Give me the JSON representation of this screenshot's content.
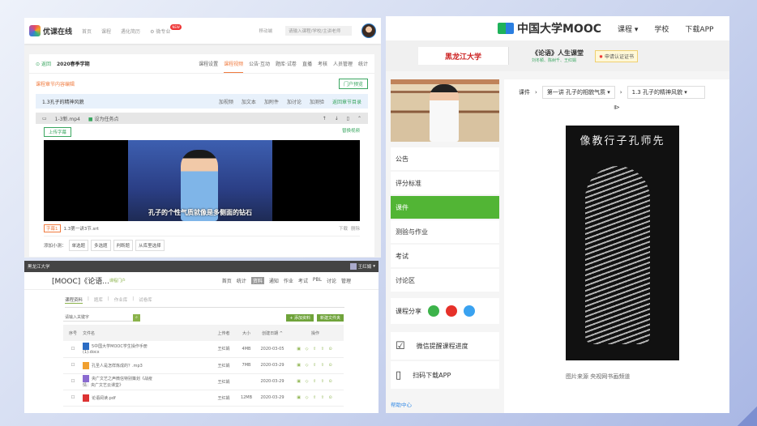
{
  "youke": {
    "brand": "优课在线",
    "nav": [
      "首页",
      "课程",
      "遇化简历",
      "微专业"
    ],
    "badge": "NEW",
    "mobile": "移动端",
    "search_placeholder": "请输入课程/学校/主讲老师",
    "back": "返回",
    "term": "2020春季学期",
    "tabs": [
      "课程设置",
      "课程视频",
      "公告·互动",
      "题库·试卷",
      "直播",
      "考核",
      "人员管理",
      "统计"
    ],
    "active_tab": "课程视频",
    "section_title": "课程章节内容编辑",
    "preview_btn": "门户预览",
    "chapter": "1.3孔子的精神风貌",
    "actions": [
      "加视频",
      "加文本",
      "加附件",
      "加讨论",
      "加测验"
    ],
    "back_catalog": "返回章节目录",
    "video_file": "1-3新.mp4",
    "task_point": "设为任务点",
    "upload_sub": "上传字幕",
    "replace_video": "替换视频",
    "subtitle_text": "孔子的个性气质就像是多侧面的钻石",
    "sub_tag": "字幕1",
    "sub_file": "1.3第一讲3节.srt",
    "download": "下载",
    "delete": "删除",
    "add_quiz": "添加小测：",
    "quiz_types": [
      "单选题",
      "多选题",
      "判断题",
      "从库里选择"
    ]
  },
  "spoc": {
    "school": "黑龙江大学",
    "user": "王红娟",
    "course": "[MOOC]《论语...",
    "portal": "课程门户",
    "nav": [
      "首页",
      "统计",
      "资料",
      "通知",
      "作业",
      "考试",
      "PBL",
      "讨论",
      "管理"
    ],
    "active_nav": "资料",
    "subtabs": [
      "课程资料",
      "题库",
      "作业库",
      "试卷库"
    ],
    "search_placeholder": "请输入关键字",
    "add_btn": "+ 添加资料",
    "folder_btn": "新建文件夹",
    "columns": [
      "序号",
      "文件名",
      "上传者",
      "大小",
      "创建日期 ^",
      "操作"
    ],
    "rows": [
      {
        "name": "5中国大学MOOC学生操作手册",
        "name2": "(1).docx",
        "uploader": "王红娟",
        "size": "4MB",
        "date": "2020-03-05",
        "color": "#2b6cc4"
      },
      {
        "name": "孔圣人是怎样炼成的？.mp3",
        "name2": "",
        "uploader": "王红娟",
        "size": "7MB",
        "date": "2020-03-29",
        "color": "#f0a030"
      },
      {
        "name": "央广文艺之声微信特别策划《战疫",
        "name2": "情：央广文艺云课堂》",
        "uploader": "王红娟",
        "size": "",
        "date": "2020-03-29",
        "color": "#8a6ad0"
      },
      {
        "name": "论语阅读.pdf",
        "name2": "",
        "uploader": "王红娟",
        "size": "12MB",
        "date": "2020-03-29",
        "color": "#d33"
      }
    ]
  },
  "mooc": {
    "brand": "中国大学MOOC",
    "nav": [
      "课程 ▾",
      "学校",
      "下载APP"
    ],
    "university": "黑龙江大学",
    "course": "《论语》人生课堂",
    "teachers": "刘冬颖、陈树千、王红娟",
    "cert": "申请认证证书",
    "menu": [
      "公告",
      "评分标准",
      "课件",
      "测验与作业",
      "考试",
      "讨论区"
    ],
    "active_menu": "课件",
    "share": "课程分享",
    "wechat": "微信提醒课程进度",
    "app": "扫码下载APP",
    "help": "帮助中心",
    "crumb": "课件",
    "chapter": "第一讲 孔子的相貌气质",
    "lesson": "1.3 孔子的精神风貌",
    "painting_title": "像教行子孔师先",
    "caption": "图片来源 央视网书画频道"
  }
}
